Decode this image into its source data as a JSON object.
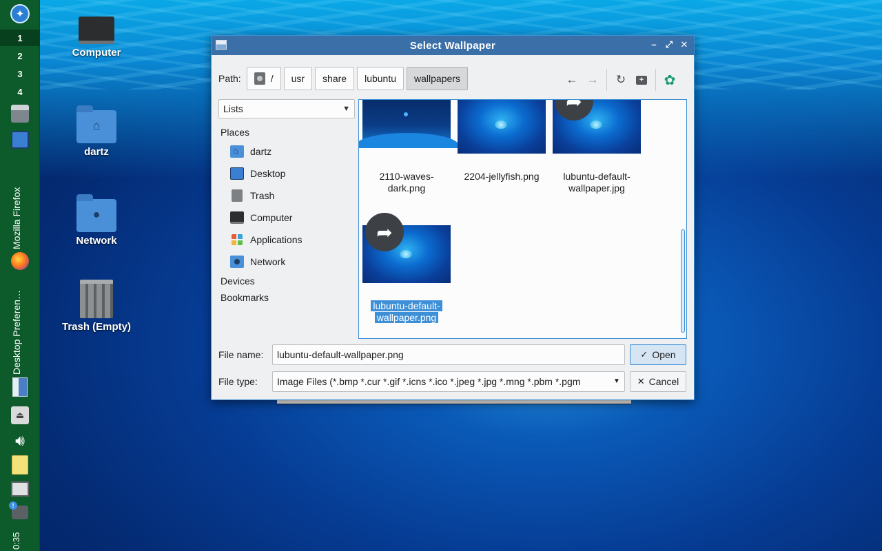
{
  "panel": {
    "menu_icon": "lubuntu-logo-icon",
    "desktops": [
      "1",
      "2",
      "3",
      "4"
    ],
    "taskbar_items": [
      "Mozilla Firefox",
      "Desktop Preferen…"
    ],
    "clock": "0:35"
  },
  "desktop": {
    "icons": [
      {
        "label": "Computer"
      },
      {
        "label": "dartz"
      },
      {
        "label": "Network"
      },
      {
        "label": "Trash (Empty)"
      }
    ]
  },
  "dialog": {
    "title": "Select Wallpaper",
    "path_label": "Path:",
    "breadcrumbs": [
      "/",
      "usr",
      "share",
      "lubuntu",
      "wallpapers"
    ],
    "view_mode": "Lists",
    "places_header": "Places",
    "places": [
      "dartz",
      "Desktop",
      "Trash",
      "Computer",
      "Applications",
      "Network"
    ],
    "devices_header": "Devices",
    "bookmarks_header": "Bookmarks",
    "files": [
      {
        "name": "2110-waves-dark.png",
        "line1": "2110-waves-",
        "line2": "dark.png"
      },
      {
        "name": "2204-jellyfish.png",
        "line1": "2204-jellyfish.png",
        "line2": ""
      },
      {
        "name": "lubuntu-default-wallpaper.jpg",
        "line1": "lubuntu-default-",
        "line2": "wallpaper.jpg"
      },
      {
        "name": "lubuntu-default-wallpaper.png",
        "line1": "lubuntu-default-",
        "line2": "wallpaper.png"
      }
    ],
    "file_name_label": "File name:",
    "file_name_value": "lubuntu-default-wallpaper.png",
    "file_type_label": "File type:",
    "file_type_value": "Image Files (*.bmp *.cur *.gif *.icns *.ico *.jpeg *.jpg *.mng *.pbm *.pgm",
    "open_label": "Open",
    "cancel_label": "Cancel",
    "colors": {
      "titlebar": "#3b6fa8",
      "accent": "#3c8fd6",
      "selection": "#3d8fd8"
    }
  }
}
